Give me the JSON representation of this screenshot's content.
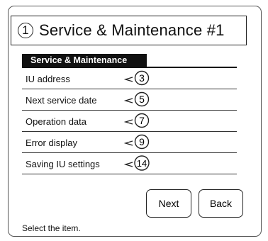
{
  "title": {
    "number": "1",
    "text": "Service & Maintenance #1"
  },
  "tab": {
    "label": "Service & Maintenance"
  },
  "menu": [
    {
      "label": "IU address",
      "callout": "3"
    },
    {
      "label": "Next service date",
      "callout": "5"
    },
    {
      "label": "Operation data",
      "callout": "7"
    },
    {
      "label": "Error display",
      "callout": "9"
    },
    {
      "label": "Saving IU settings",
      "callout": "14"
    }
  ],
  "buttons": {
    "next": "Next",
    "back": "Back"
  },
  "status": {
    "hint": "Select the item."
  }
}
